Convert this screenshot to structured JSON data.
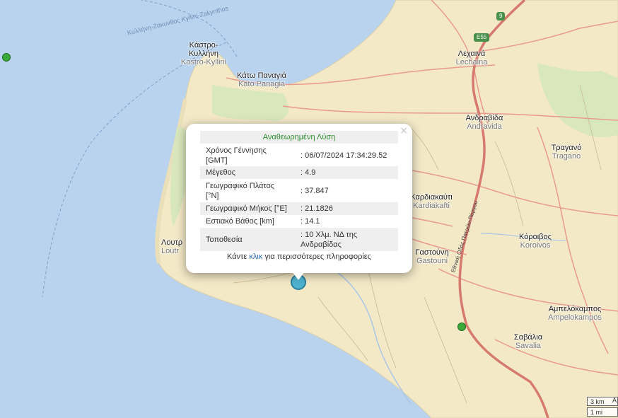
{
  "map": {
    "places": [
      {
        "id": "kastro",
        "greek": "Κάστρο-\nΚυλλήνη",
        "latin": "Kastro-Kyllini"
      },
      {
        "id": "kato",
        "greek": "Κάτω Παναγιά",
        "latin": "Kato Panagia"
      },
      {
        "id": "lechaina",
        "greek": "Λεχαινά",
        "latin": "Lechaina"
      },
      {
        "id": "andravida",
        "greek": "Ανδραβίδα",
        "latin": "Andravida"
      },
      {
        "id": "tragano",
        "greek": "Τραγανό",
        "latin": "Tragano"
      },
      {
        "id": "kardiakafti",
        "greek": "Καρδιακαύτι",
        "latin": "Kardiakafti"
      },
      {
        "id": "koroivos",
        "greek": "Κόροιβος",
        "latin": "Koroivos"
      },
      {
        "id": "loutra",
        "greek": "Λουτρ",
        "latin": "Loutr"
      },
      {
        "id": "gastouni",
        "greek": "Γαστούνη",
        "latin": "Gastouni"
      },
      {
        "id": "ampelokampos",
        "greek": "Αμπελόκαμπος",
        "latin": "Ampelokampos"
      },
      {
        "id": "savalia",
        "greek": "Σαβάλια",
        "latin": "Savalia"
      }
    ],
    "ferry_label": "Κυλλήνη-Ζάκυνθος Kyllini-Zakynthos",
    "highway_label": "Εθνική Οδός Πατρών-Πύργου",
    "shields": {
      "nine": "9",
      "e55": "E55"
    },
    "colors": {
      "sea": "#b9d3ee",
      "land": "#f3e9c7",
      "park": "#d9e7bd",
      "road": "#e99a8f",
      "highway": "#d77a6e",
      "quake": "#4fb3cf",
      "quake_small": "#3aaa3a"
    }
  },
  "popup": {
    "title": "Αναθεωρημένη Λύση",
    "rows": [
      {
        "key": "Χρόνος Γέννησης [GMT]",
        "value": ": 06/07/2024 17:34:29.52"
      },
      {
        "key": "Μέγεθος",
        "value": ": 4.9"
      },
      {
        "key": "Γεωγραφικό Πλάτος [°N]",
        "value": ": 37.847"
      },
      {
        "key": "Γεωγραφικό Μήκος [°E]",
        "value": ": 21.1826"
      },
      {
        "key": "Εστιακό Βάθος [km]",
        "value": ": 14.1"
      },
      {
        "key": "Τοποθεσία",
        "value": ": 10 Χλμ. ΝΔ της Ανδραβίδας"
      }
    ],
    "footer_pre": "Κάντε ",
    "footer_link": "κλικ",
    "footer_post": " για περισσότερες πληροφορίες",
    "close_glyph": "×"
  },
  "scale": {
    "km": "3 km",
    "mi": "1 mi"
  },
  "attribution": "A"
}
